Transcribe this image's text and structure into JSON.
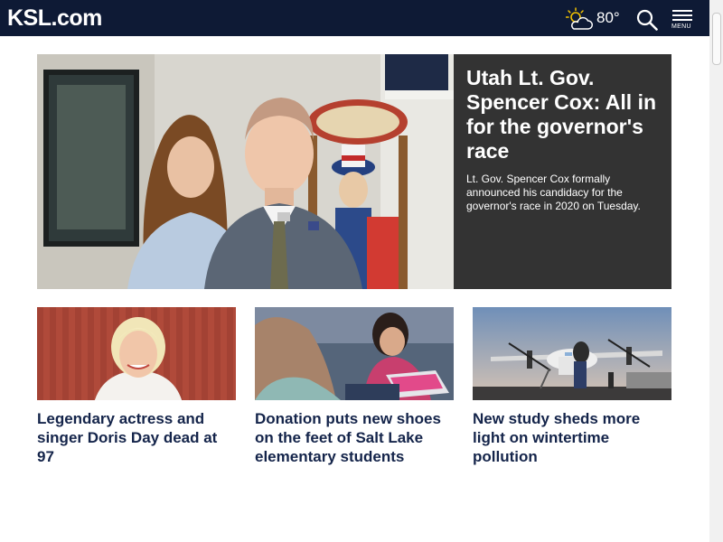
{
  "header": {
    "logo": "KSL.com",
    "weather": {
      "icon": "partly-cloudy-icon",
      "temperature": "80°"
    },
    "search_icon": "search-icon",
    "menu_label": "MENU",
    "background_color": "#0e1a35"
  },
  "hero": {
    "headline": "Utah Lt. Gov. Spencer Cox: All in for the governor's race",
    "summary": "Lt. Gov. Spencer Cox formally announced his candidacy for the governor's race in 2020 on Tuesday.",
    "panel_color": "#333333"
  },
  "stories": [
    {
      "title": "Legendary actress and singer Doris Day dead at 97"
    },
    {
      "title": "Donation puts new shoes on the feet of Salt Lake elementary students"
    },
    {
      "title": "New study sheds more light on wintertime pollution"
    }
  ],
  "colors": {
    "headline_text": "#14244a",
    "panel_text": "#ffffff"
  }
}
